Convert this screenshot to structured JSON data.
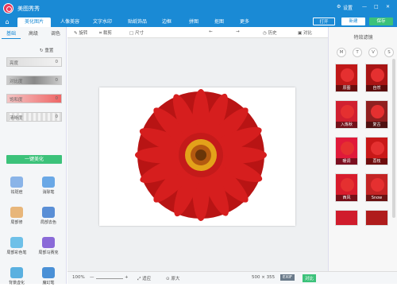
{
  "app": {
    "title": "美图秀秀",
    "settings": "设置",
    "brand_color": "#1a8ad5"
  },
  "nav": {
    "tabs": [
      "美化图片",
      "人像美容",
      "文字水印",
      "贴纸饰品",
      "边框",
      "拼图",
      "抠图",
      "更多"
    ],
    "active": "美化图片",
    "buttons": {
      "open": "打开",
      "new": "新建",
      "save": "保存"
    }
  },
  "left": {
    "tabs": [
      "基础",
      "高级",
      "调色"
    ],
    "reset": "重置",
    "sliders": [
      {
        "label": "亮度",
        "value": "0"
      },
      {
        "label": "对比度",
        "value": "0"
      },
      {
        "label": "饱和度",
        "value": "0"
      },
      {
        "label": "清晰度",
        "value": "0"
      }
    ],
    "one_click": "一键美化",
    "tools": [
      "祛斑痘",
      "消除笔",
      "局部修",
      "局部去色",
      "局部彩色笔",
      "局部马赛克",
      "背景虚化",
      "魔幻笔"
    ]
  },
  "toolbar": {
    "rotate": "旋转",
    "crop": "裁剪",
    "size": "尺寸",
    "history": "历史",
    "compare": "对比"
  },
  "bottom": {
    "zoom": "100%",
    "fit": "适应",
    "original": "原大",
    "dims": "500 × 355",
    "exif": "EXIF",
    "compare": "对比"
  },
  "right": {
    "header": "特效滤镜",
    "filter_tabs": [
      "M",
      "T",
      "V",
      "S"
    ],
    "filters": [
      "原图",
      "自然",
      "入炼秋",
      "复古",
      "暖调",
      "荔枝",
      "西风",
      "Snow"
    ]
  }
}
